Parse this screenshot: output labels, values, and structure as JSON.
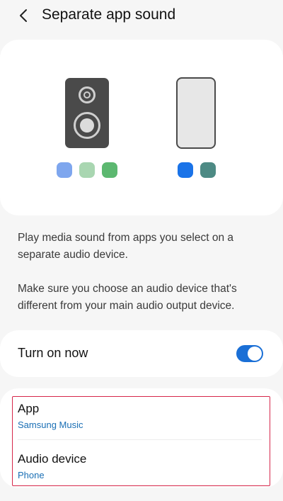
{
  "header": {
    "title": "Separate app sound",
    "back_icon": "chevron-left-icon"
  },
  "illustration": {
    "devices": [
      "speaker-icon",
      "phone-icon"
    ],
    "speaker_dot_colors": [
      "#7ea6ee",
      "#a9d6b1",
      "#5cb870"
    ],
    "phone_dot_colors": [
      "#1a73e8",
      "#4d8a84"
    ]
  },
  "description": {
    "paragraph1": "Play media sound from apps you select on a separate audio device.",
    "paragraph2": "Make sure you choose an audio device that's different from your main audio output device."
  },
  "toggle": {
    "label": "Turn on now",
    "state": "on",
    "accent_color": "#1a6fd6"
  },
  "settings": {
    "items": [
      {
        "title": "App",
        "value": "Samsung Music"
      },
      {
        "title": "Audio device",
        "value": "Phone"
      }
    ],
    "value_color": "#1a6fb5",
    "highlight_color": "#d6264a"
  }
}
